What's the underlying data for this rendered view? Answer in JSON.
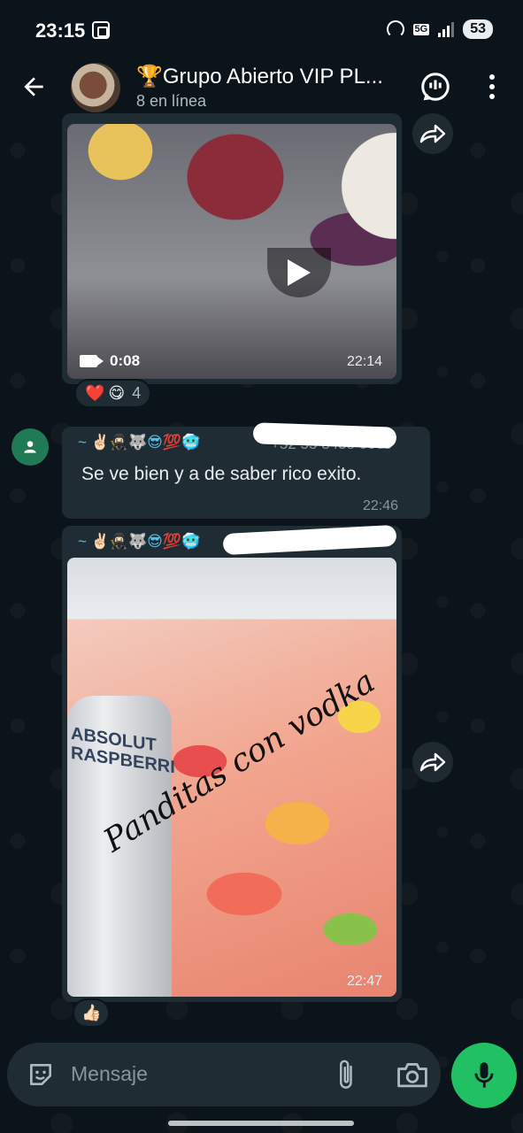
{
  "status_bar": {
    "time": "23:15",
    "network": "5G",
    "battery": "53"
  },
  "header": {
    "title": "🏆Grupo Abierto VIP PL...",
    "subtitle": "8 en línea"
  },
  "messages": [
    {
      "type": "video",
      "duration": "0:08",
      "time": "22:14",
      "reactions": [
        "❤️",
        "😋"
      ],
      "reaction_count": "4"
    },
    {
      "type": "text",
      "sender": "~ ✌🏻🥷🏻🐺😎💯🥶",
      "sender_phone_partial": "+52 55 3438 0569",
      "text": "Se ve bien y a de saber rico exito.",
      "time": "22:46"
    },
    {
      "type": "image",
      "sender": "~ ✌🏻🥷🏻🐺😎💯🥶",
      "image_caption_overlay": "Panditas con vodka",
      "bottle_label": "ABSOLUT RASPBERRI",
      "time": "22:47",
      "reactions": [
        "👍🏻"
      ]
    }
  ],
  "input": {
    "placeholder": "Mensaje"
  },
  "colors": {
    "background": "#0b141a",
    "bubble": "#202c33",
    "accent_green": "#21c063",
    "sender_name": "#53bdeb"
  },
  "icons": [
    "back-arrow-icon",
    "call-icon",
    "more-vert-icon",
    "play-icon",
    "video-camera-icon",
    "forward-icon",
    "person-icon",
    "emoji-icon",
    "attach-icon",
    "camera-icon",
    "mic-icon"
  ]
}
